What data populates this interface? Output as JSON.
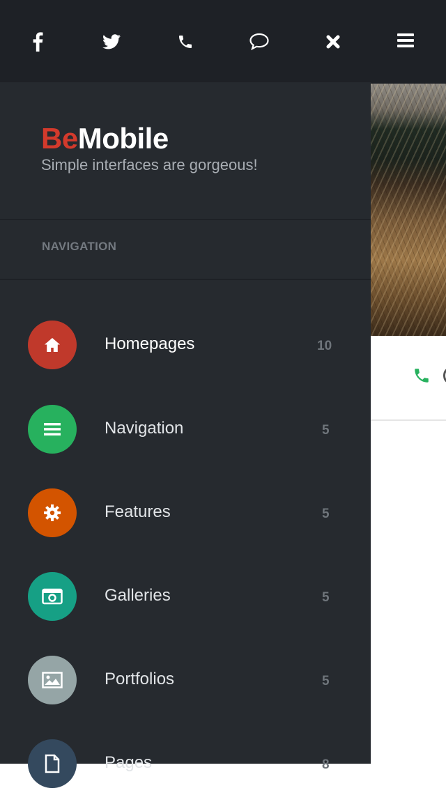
{
  "brand": {
    "logo_accent": "Be",
    "logo_rest": "Mobile",
    "tagline": "Simple interfaces are gorgeous!",
    "accent_color": "#d33a2c"
  },
  "topbar": {
    "icons": [
      "facebook-icon",
      "twitter-icon",
      "phone-icon",
      "chat-icon",
      "close-icon",
      "menu-icon"
    ]
  },
  "navigation": {
    "heading": "NAVIGATION",
    "items": [
      {
        "label": "Homepages",
        "count": "10",
        "icon": "home-icon",
        "color": "#c0392b",
        "active": true
      },
      {
        "label": "Navigation",
        "count": "5",
        "icon": "list-icon",
        "color": "#27b15e"
      },
      {
        "label": "Features",
        "count": "5",
        "icon": "gear-icon",
        "color": "#d35400"
      },
      {
        "label": "Galleries",
        "count": "5",
        "icon": "camera-icon",
        "color": "#16a085"
      },
      {
        "label": "Portfolios",
        "count": "5",
        "icon": "image-icon",
        "color": "#95a5a6"
      },
      {
        "label": "Pages",
        "count": "8",
        "icon": "file-icon",
        "color": "#34495e"
      }
    ]
  },
  "page": {
    "call_icon_color": "#27b15e"
  }
}
